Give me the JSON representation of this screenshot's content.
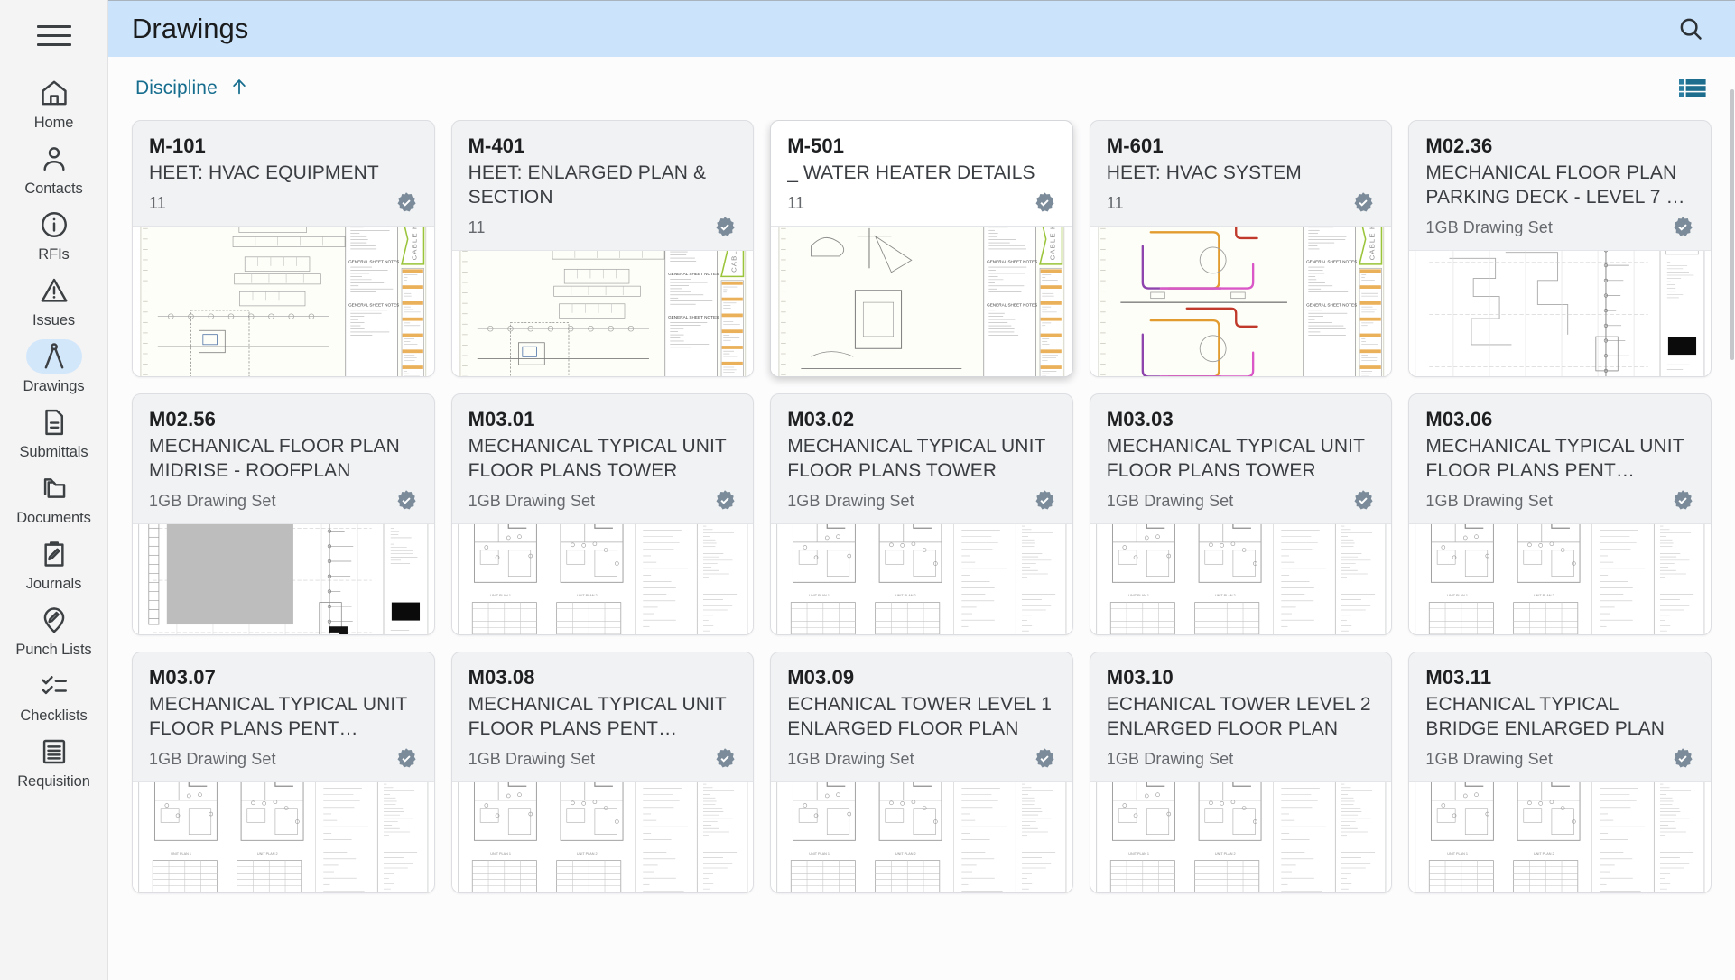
{
  "sidebar": {
    "menu_icon": "hamburger-icon",
    "items": [
      {
        "label": "Home",
        "icon": "home-icon",
        "active": false
      },
      {
        "label": "Contacts",
        "icon": "person-icon",
        "active": false
      },
      {
        "label": "RFIs",
        "icon": "info-circle-icon",
        "active": false
      },
      {
        "label": "Issues",
        "icon": "warning-triangle-icon",
        "active": false
      },
      {
        "label": "Drawings",
        "icon": "compass-icon",
        "active": true
      },
      {
        "label": "Submittals",
        "icon": "document-icon",
        "active": false
      },
      {
        "label": "Documents",
        "icon": "folders-icon",
        "active": false
      },
      {
        "label": "Journals",
        "icon": "clipboard-pencil-icon",
        "active": false
      },
      {
        "label": "Punch Lists",
        "icon": "pin-pencil-icon",
        "active": false
      },
      {
        "label": "Checklists",
        "icon": "checklist-icon",
        "active": false
      },
      {
        "label": "Requisition",
        "icon": "requisition-icon",
        "active": false
      }
    ]
  },
  "header": {
    "title": "Drawings",
    "search_icon": "search-icon"
  },
  "toolbar": {
    "sort_label": "Discipline",
    "sort_direction_icon": "arrow-up-icon",
    "view_toggle_icon": "list-view-icon",
    "accent_color": "#166d8e"
  },
  "colors": {
    "header_bg": "#cbe4fb",
    "sidebar_bg": "#f4f4f5",
    "card_bg": "#f1f2f4",
    "accent": "#166d8e",
    "badge": "#7b8b99",
    "active_pill": "#d3e7fb"
  },
  "cards": [
    {
      "code": "M-101",
      "title": "HEET: HVAC EQUIPMENT",
      "meta": "11",
      "badge": true,
      "raised": false,
      "thumb": "titleblock",
      "sheet": "M-101"
    },
    {
      "code": "M-401",
      "title": "HEET: ENLARGED PLAN & SECTION",
      "meta": "11",
      "badge": true,
      "raised": false,
      "thumb": "titleblock",
      "sheet": "M-401"
    },
    {
      "code": "M-501",
      "title": "_ WATER HEATER DETAILS",
      "meta": "11",
      "badge": true,
      "raised": true,
      "thumb": "details",
      "sheet": "M-501"
    },
    {
      "code": "M-601",
      "title": "HEET: HVAC SYSTEM",
      "meta": "11",
      "badge": true,
      "raised": false,
      "thumb": "piping",
      "sheet": "M-601"
    },
    {
      "code": "M02.36",
      "title": "MECHANICAL FLOOR PLAN PARKING DECK - LEVEL 7 …",
      "meta": "1GB Drawing Set",
      "badge": true,
      "raised": false,
      "thumb": "floorplan",
      "sheet": ""
    },
    {
      "code": "M02.56",
      "title": "MECHANICAL FLOOR PLAN MIDRISE - ROOFPLAN",
      "meta": "1GB Drawing Set",
      "badge": true,
      "raised": false,
      "thumb": "roofplan",
      "sheet": ""
    },
    {
      "code": "M03.01",
      "title": "MECHANICAL TYPICAL UNIT FLOOR PLANS TOWER",
      "meta": "1GB Drawing Set",
      "badge": true,
      "raised": false,
      "thumb": "unitplan",
      "sheet": ""
    },
    {
      "code": "M03.02",
      "title": "MECHANICAL TYPICAL UNIT FLOOR PLANS TOWER",
      "meta": "1GB Drawing Set",
      "badge": true,
      "raised": false,
      "thumb": "unitplan",
      "sheet": ""
    },
    {
      "code": "M03.03",
      "title": "MECHANICAL TYPICAL UNIT FLOOR PLANS TOWER",
      "meta": "1GB Drawing Set",
      "badge": true,
      "raised": false,
      "thumb": "unitplan",
      "sheet": ""
    },
    {
      "code": "M03.06",
      "title": "MECHANICAL TYPICAL UNIT FLOOR PLANS PENT…",
      "meta": "1GB Drawing Set",
      "badge": true,
      "raised": false,
      "thumb": "unitplan",
      "sheet": ""
    },
    {
      "code": "M03.07",
      "title": "MECHANICAL TYPICAL UNIT FLOOR PLANS PENT…",
      "meta": "1GB Drawing Set",
      "badge": true,
      "raised": false,
      "thumb": "unitplan",
      "sheet": ""
    },
    {
      "code": "M03.08",
      "title": "MECHANICAL TYPICAL UNIT FLOOR PLANS PENT…",
      "meta": "1GB Drawing Set",
      "badge": true,
      "raised": false,
      "thumb": "unitplan",
      "sheet": ""
    },
    {
      "code": "M03.09",
      "title": "ECHANICAL TOWER LEVEL 1 ENLARGED FLOOR PLAN",
      "meta": "1GB Drawing Set",
      "badge": true,
      "raised": false,
      "thumb": "unitplan",
      "sheet": ""
    },
    {
      "code": "M03.10",
      "title": "ECHANICAL TOWER LEVEL 2 ENLARGED FLOOR PLAN",
      "meta": "1GB Drawing Set",
      "badge": false,
      "raised": false,
      "thumb": "unitplan",
      "sheet": ""
    },
    {
      "code": "M03.11",
      "title": "ECHANICAL TYPICAL BRIDGE ENLARGED PLAN",
      "meta": "1GB Drawing Set",
      "badge": true,
      "raised": false,
      "thumb": "unitplan",
      "sheet": ""
    }
  ]
}
